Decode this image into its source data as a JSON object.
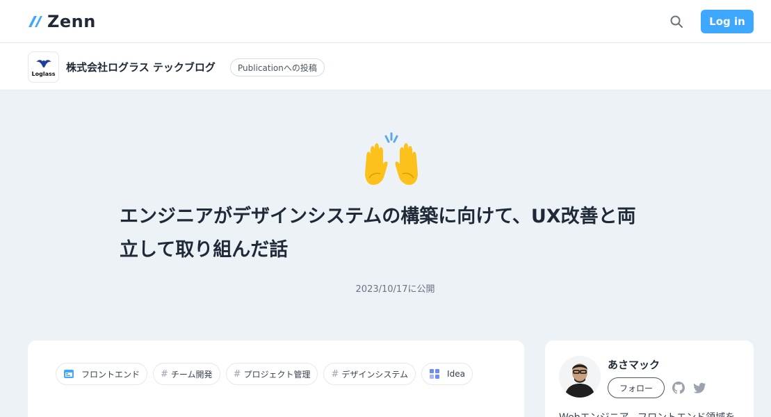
{
  "header": {
    "logo_text": "Zenn",
    "logo_color": "#3ea8ff",
    "search_icon": "search-icon",
    "login_label": "Log in",
    "login_color": "#3ea8ff"
  },
  "publication": {
    "logo_text": "Loglass",
    "name": "株式会社ログラス テックブログ",
    "badge": "Publicationへの投稿"
  },
  "article": {
    "emoji": "raising-hands-emoji",
    "title_line1": "エンジニアがデザインシステムの構築に向けて、UX改善と両",
    "title_line2": "立して取り組んだ話",
    "published": "2023/10/17に公開",
    "tags": [
      {
        "label": "フロントエンド",
        "icon": "frontend-topic-icon"
      },
      {
        "label": "チーム開発",
        "icon": "hash"
      },
      {
        "label": "プロジェクト管理",
        "icon": "hash"
      },
      {
        "label": "デザインシステム",
        "icon": "hash"
      },
      {
        "label": "Idea",
        "icon": "idea-topic-icon"
      }
    ]
  },
  "author": {
    "name": "あさマック",
    "follow_label": "フォロー",
    "github_icon": "github-icon",
    "twitter_icon": "twitter-icon",
    "bio": "Webエンジニア。フロントエンド領域を"
  }
}
